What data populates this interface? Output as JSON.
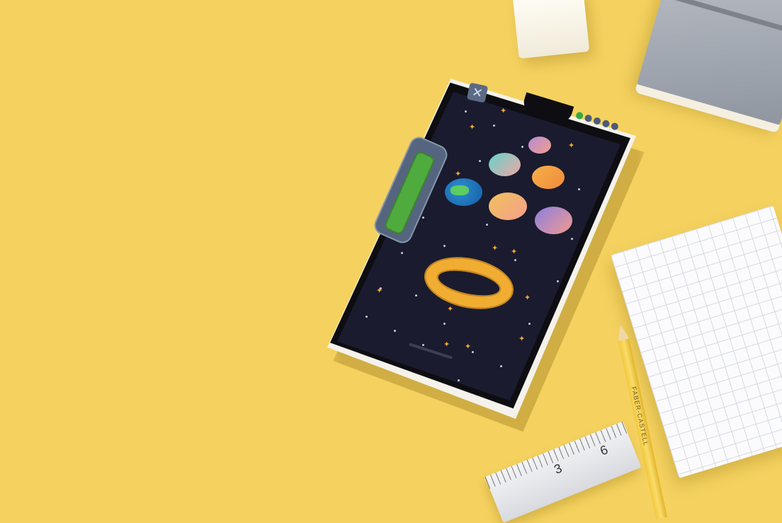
{
  "scene": {
    "background_color": "#f5d25f",
    "pencil_text": "FABER-CASTELL",
    "ruler_numbers": [
      "3",
      "6"
    ]
  },
  "game": {
    "close_icon": "close-icon",
    "close_glyph": "✕",
    "progress_fraction": 0.9,
    "level_dots_total": 5,
    "level_dots_done": 1,
    "planets": [
      "pink-planet",
      "teal-planet",
      "orange-planet",
      "earth-planet",
      "gold-planet",
      "violet-planet"
    ],
    "colors": {
      "screen_bg": "#1a1b2e",
      "progress_fill": "#4fab3e",
      "ring": "#f1ad31",
      "sparkle": "#f2a531"
    }
  }
}
